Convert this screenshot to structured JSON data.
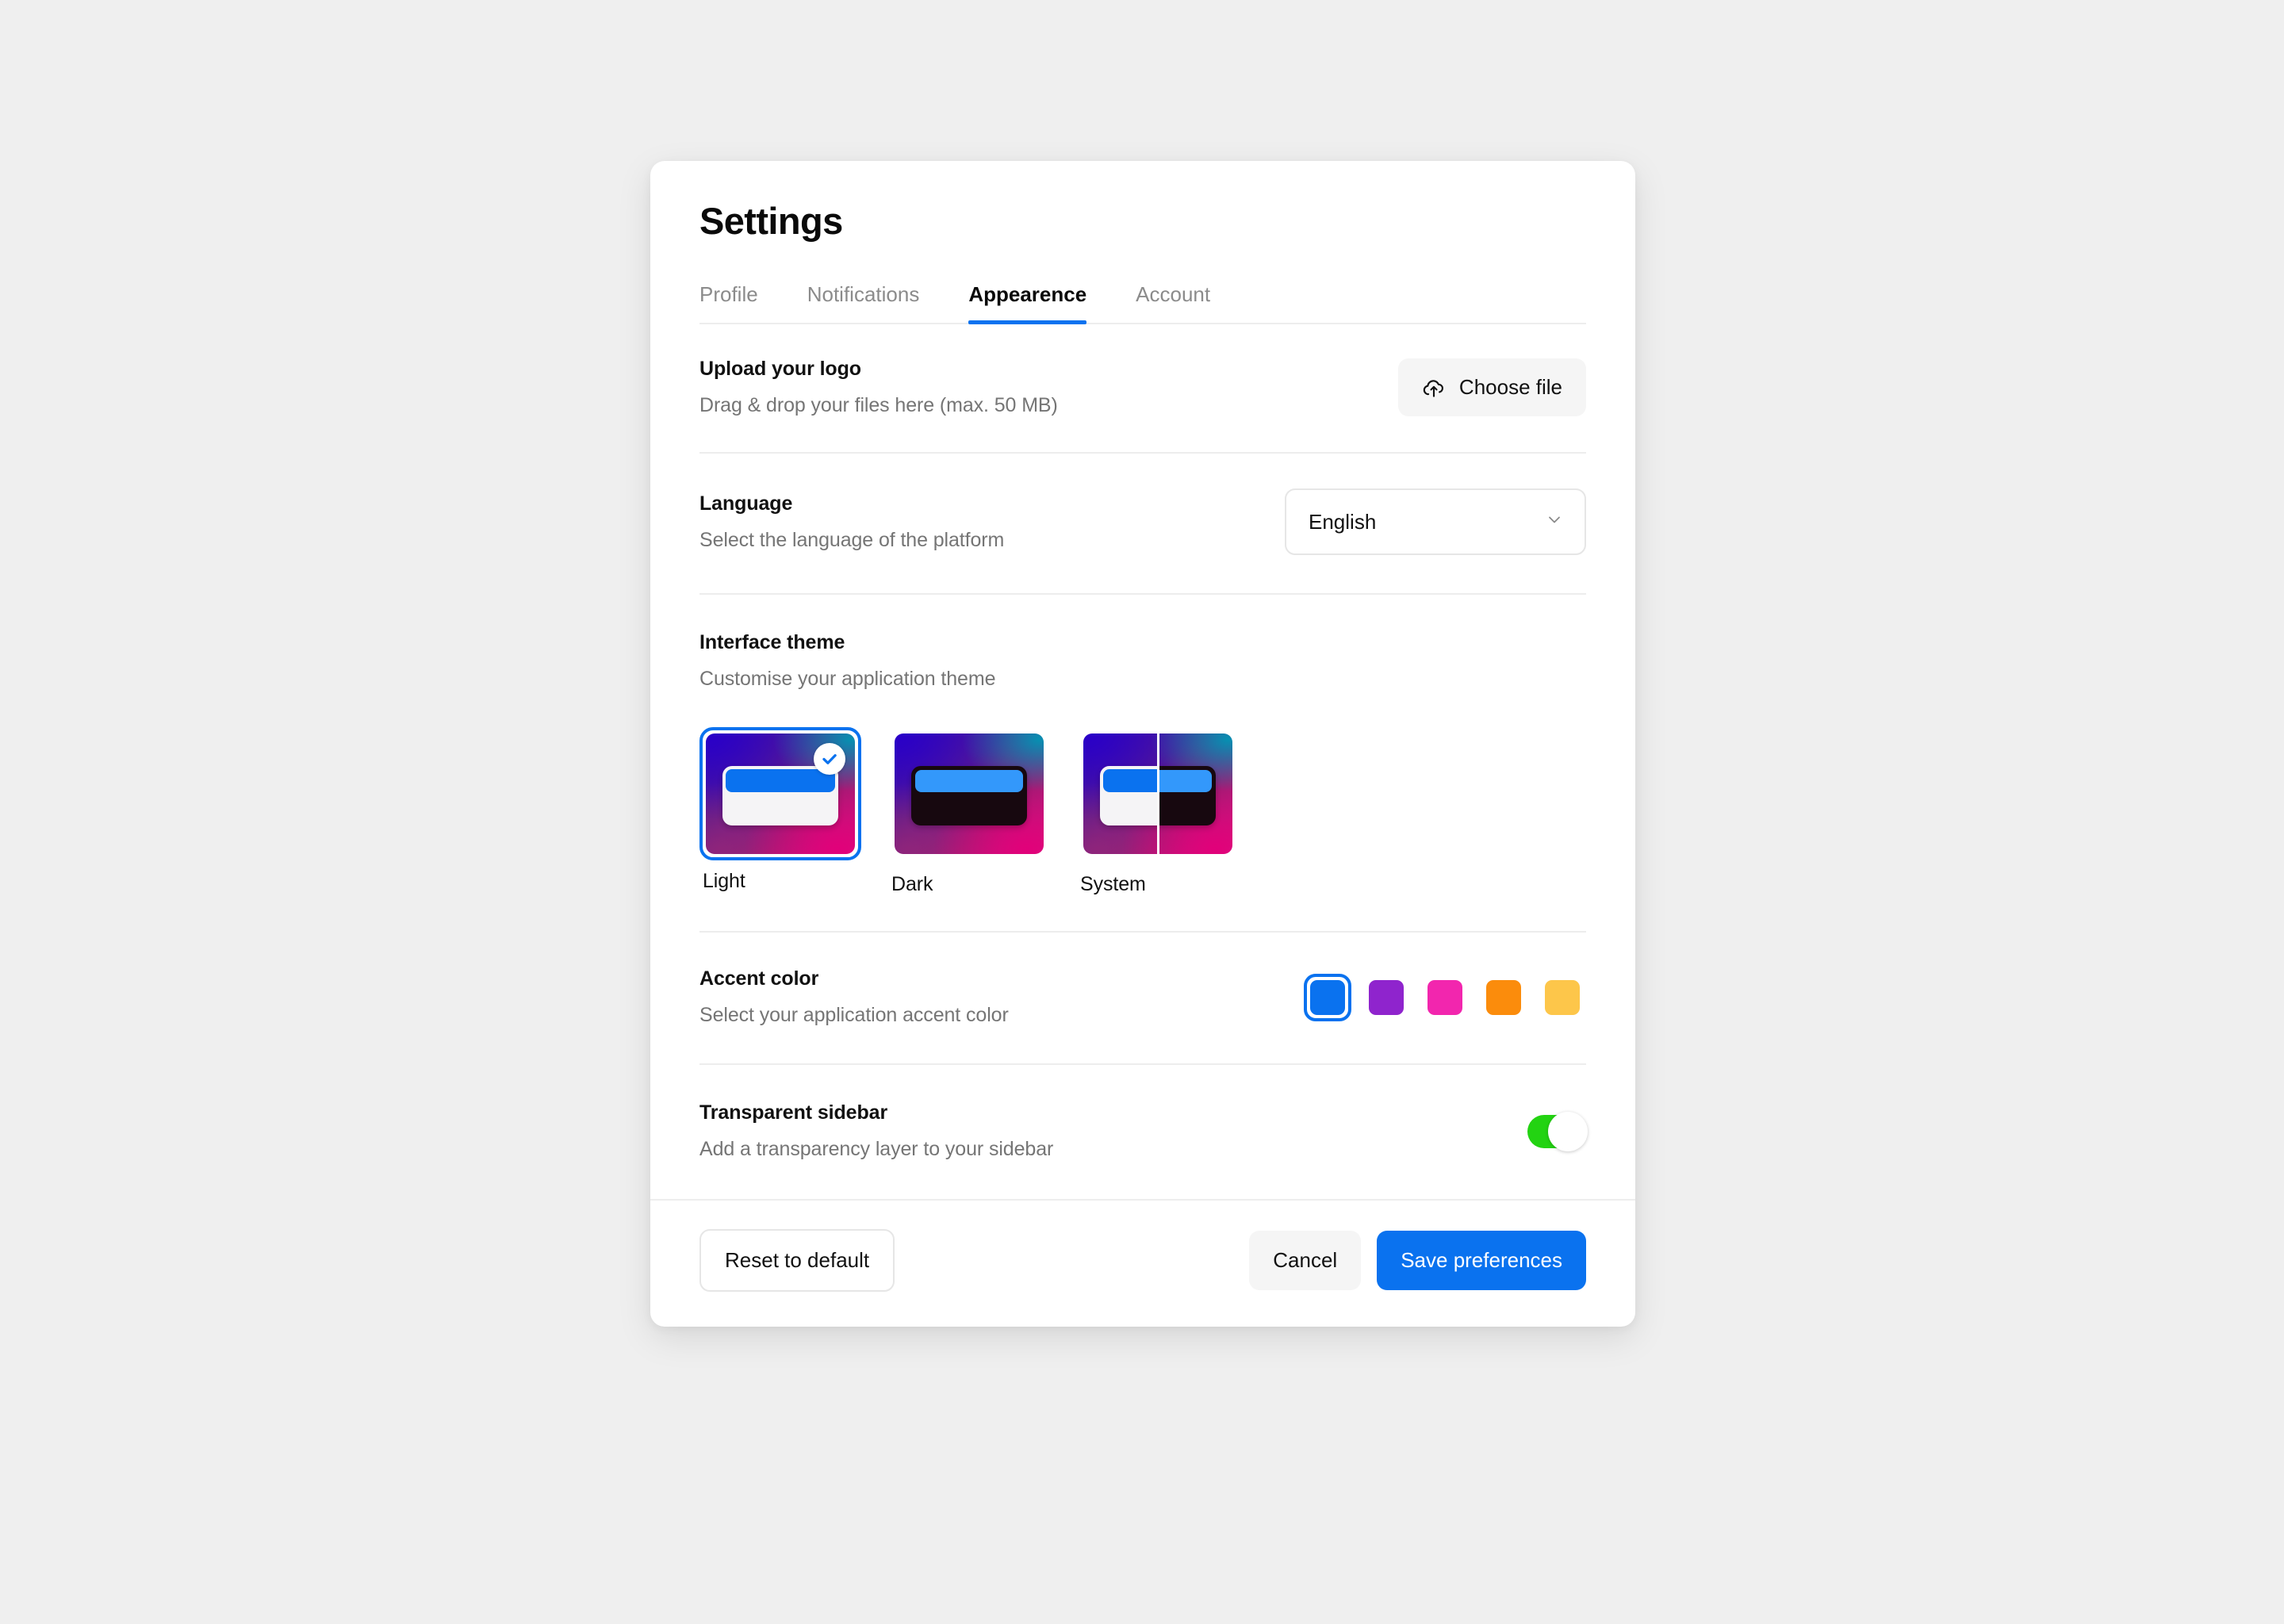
{
  "dialog": {
    "title": "Settings",
    "tabs": [
      {
        "label": "Profile",
        "active": false
      },
      {
        "label": "Notifications",
        "active": false
      },
      {
        "label": "Appearence",
        "active": true
      },
      {
        "label": "Account",
        "active": false
      }
    ]
  },
  "upload": {
    "title": "Upload your logo",
    "subtitle": "Drag & drop your files here (max. 50 MB)",
    "button_label": "Choose file",
    "button_icon": "cloud-upload-icon"
  },
  "language": {
    "title": "Language",
    "subtitle": "Select the language of the platform",
    "selected": "English",
    "chevron_icon": "chevron-down-icon"
  },
  "theme": {
    "title": "Interface theme",
    "subtitle": "Customise your application theme",
    "options": [
      {
        "label": "Light",
        "mode": "light",
        "selected": true,
        "check_icon": "check-circle-icon"
      },
      {
        "label": "Dark",
        "mode": "dark",
        "selected": false
      },
      {
        "label": "System",
        "mode": "system",
        "selected": false
      }
    ]
  },
  "accent": {
    "title": "Accent color",
    "subtitle": "Select your application accent color",
    "selected_index": 0,
    "swatches": [
      {
        "name": "blue",
        "color": "#0a72ef"
      },
      {
        "name": "purple",
        "color": "#8f24cd"
      },
      {
        "name": "pink",
        "color": "#f226ae"
      },
      {
        "name": "orange",
        "color": "#fb8c0c"
      },
      {
        "name": "yellow",
        "color": "#fdc64a"
      }
    ]
  },
  "transparent_sidebar": {
    "title": "Transparent sidebar",
    "subtitle": "Add a transparency layer to your sidebar",
    "enabled": true,
    "on_color": "#23d312"
  },
  "footer": {
    "reset_label": "Reset to default",
    "cancel_label": "Cancel",
    "save_label": "Save preferences"
  }
}
